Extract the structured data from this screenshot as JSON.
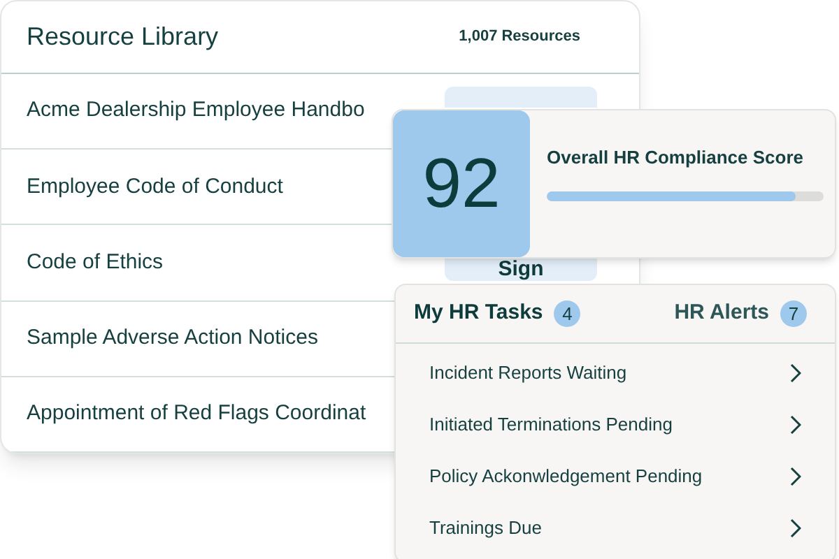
{
  "resource_library": {
    "title": "Resource Library",
    "count": "1,007 Resources",
    "rows": [
      {
        "title": "Acme Dealership Employee Handbo",
        "button": true
      },
      {
        "title": "Employee Code of Conduct"
      },
      {
        "title": "Code of Ethics",
        "action": "Sign"
      },
      {
        "title": "Sample Adverse Action Notices"
      },
      {
        "title": "Appointment of Red Flags Coordinat"
      }
    ]
  },
  "compliance": {
    "score": "92",
    "title": "Overall HR Compliance Score",
    "level": 0.9
  },
  "tasks": {
    "tabs": [
      {
        "label": "My HR Tasks",
        "count": "4",
        "selected": true
      },
      {
        "label": "HR Alerts",
        "count": "7",
        "selected": false
      }
    ],
    "items": [
      "Incident Reports Waiting",
      "Initiated Terminations Pending",
      "Policy Ackonwledgement Pending",
      "Trainings Due"
    ]
  }
}
